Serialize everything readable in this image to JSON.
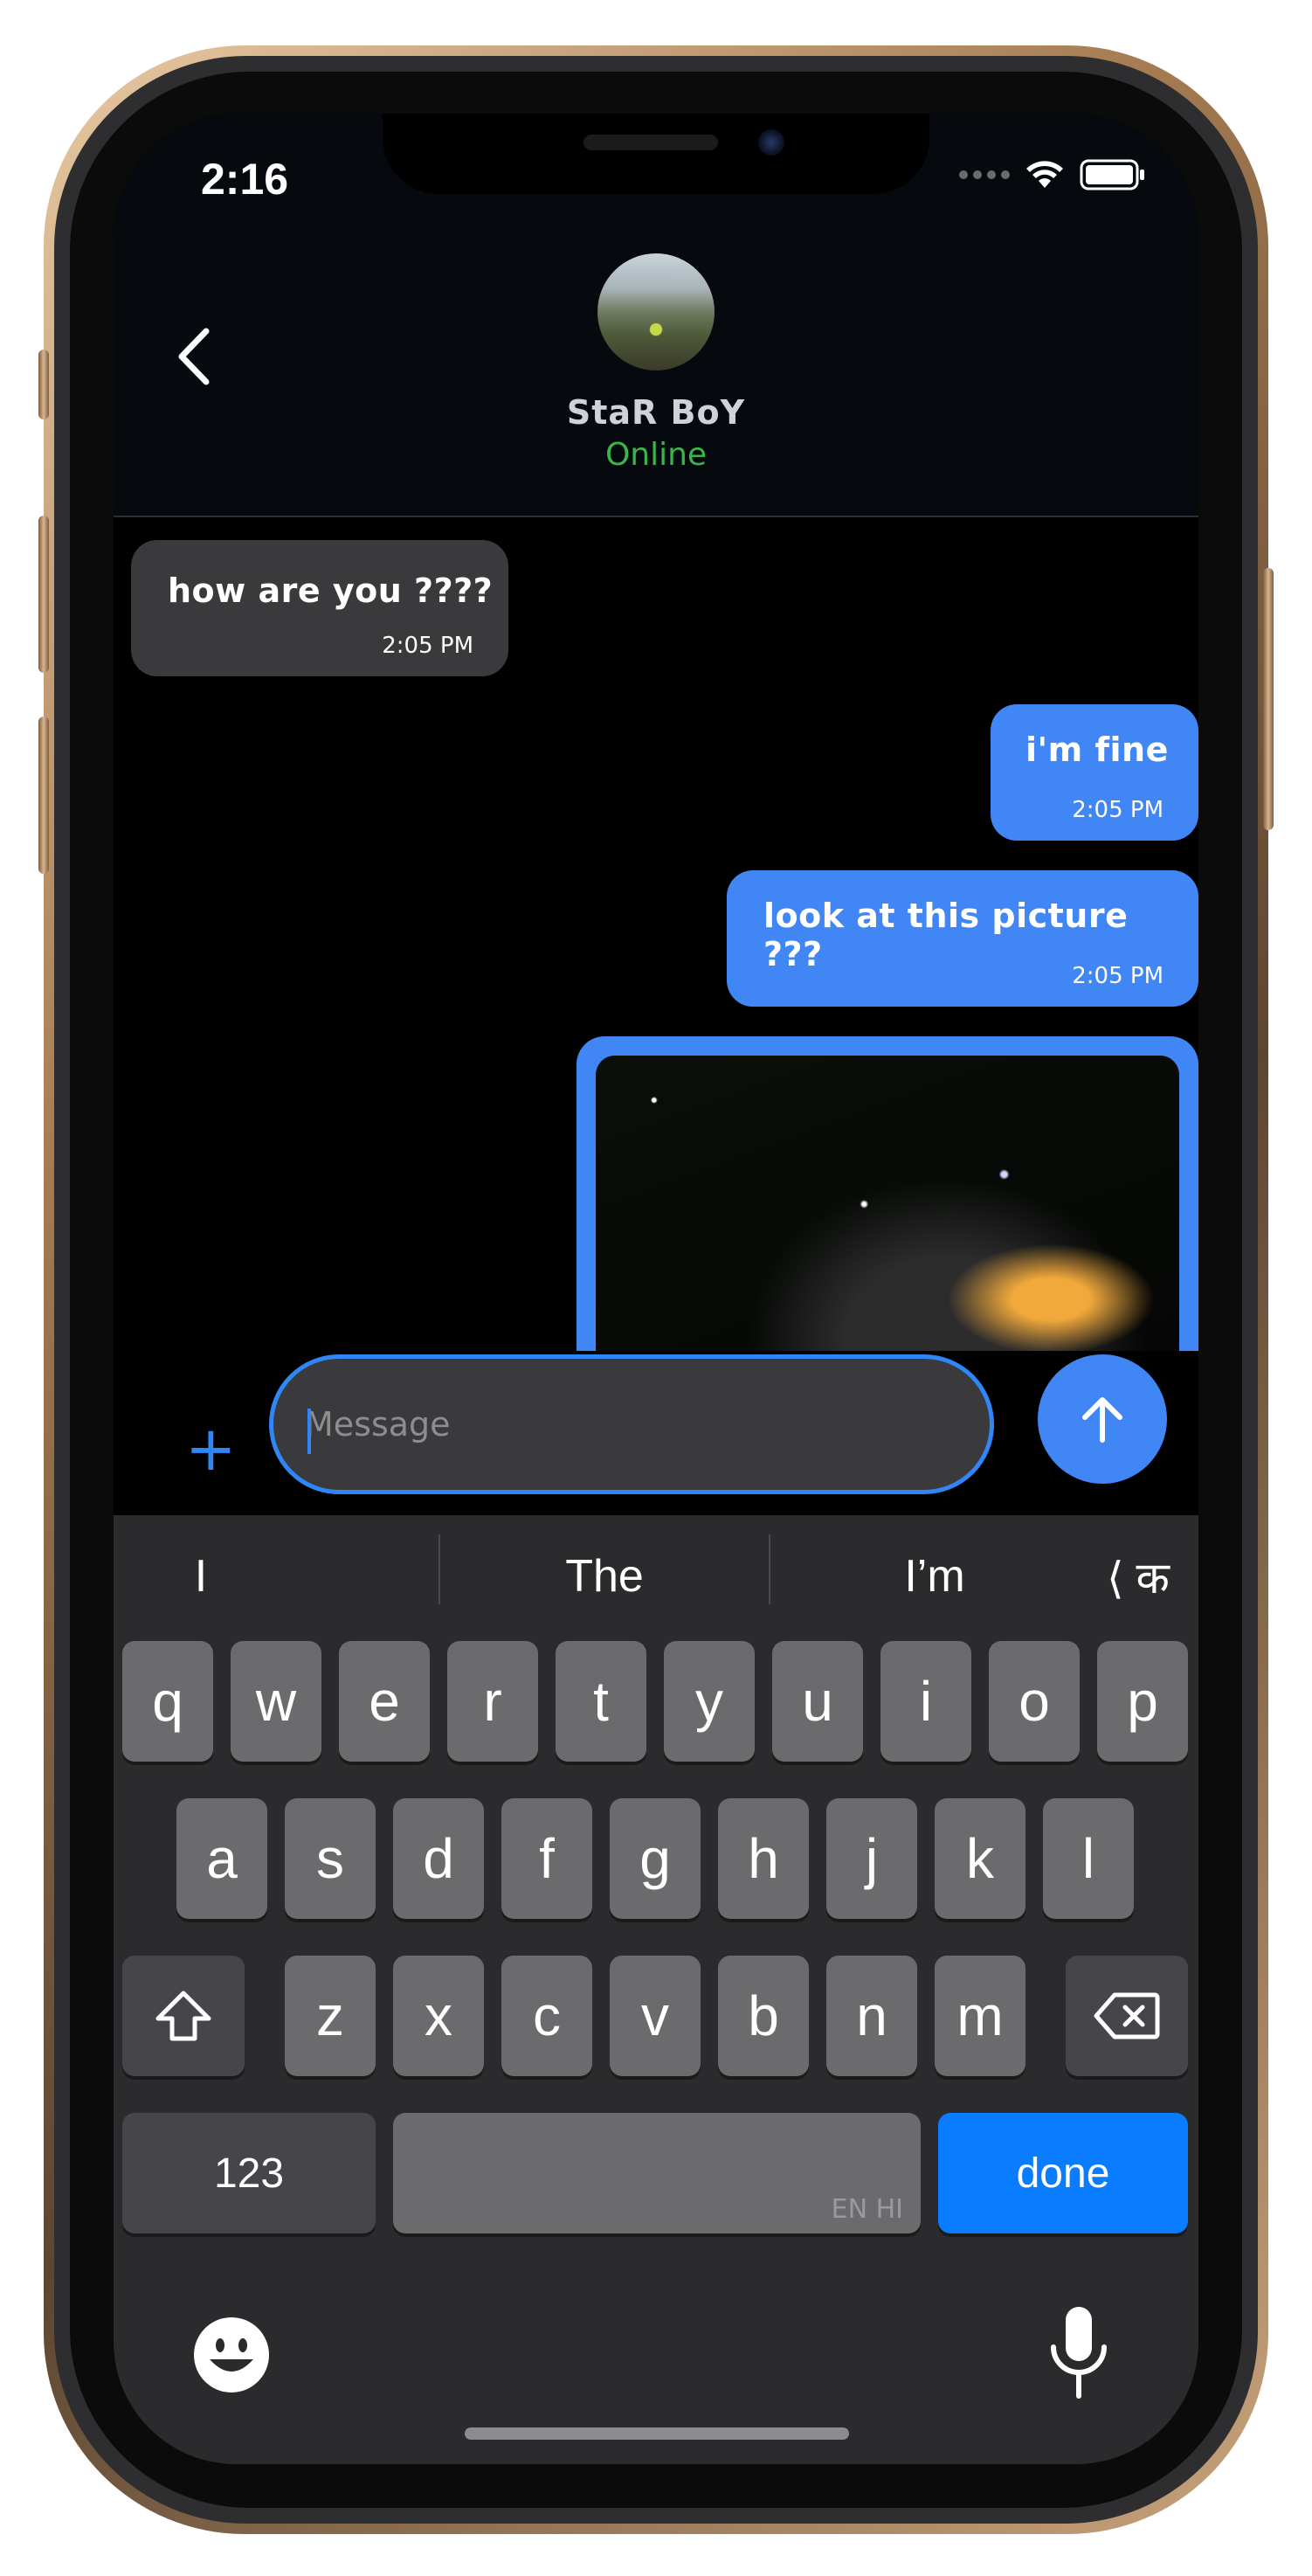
{
  "status_bar": {
    "time": "2:16"
  },
  "header": {
    "contact_name": "StaR BoY",
    "contact_status": "Online"
  },
  "messages": [
    {
      "direction": "incoming",
      "text": "how are you ????",
      "time": "2:05 PM"
    },
    {
      "direction": "outgoing",
      "text": "i'm fine",
      "time": "2:05 PM"
    },
    {
      "direction": "outgoing",
      "text": "look at this picture ???",
      "time": "2:05 PM"
    },
    {
      "direction": "outgoing",
      "type": "image"
    }
  ],
  "composer": {
    "placeholder": "Message",
    "value": ""
  },
  "keyboard": {
    "suggestions": [
      "I",
      "The",
      "I’m"
    ],
    "lang_switch": "⟨ क",
    "rows": [
      [
        "q",
        "w",
        "e",
        "r",
        "t",
        "y",
        "u",
        "i",
        "o",
        "p"
      ],
      [
        "a",
        "s",
        "d",
        "f",
        "g",
        "h",
        "j",
        "k",
        "l"
      ],
      [
        "z",
        "x",
        "c",
        "v",
        "b",
        "n",
        "m"
      ]
    ],
    "numbers_key": "123",
    "space_lang": "EN HI",
    "done_key": "done"
  },
  "colors": {
    "accent": "#4186f5",
    "online": "#39b54a",
    "done_key": "#0a7cff",
    "incoming_bubble": "#3a3a3c"
  }
}
